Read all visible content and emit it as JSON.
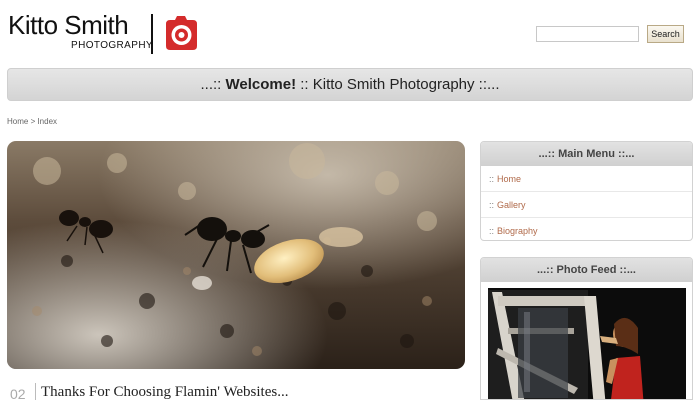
{
  "brand": {
    "name": "Kitto Smith",
    "subtitle": "PHOTOGRAPHY",
    "accent_color": "#d42b2b",
    "logo_icon": "camera-icon"
  },
  "search": {
    "placeholder": "",
    "value": "",
    "button_label": "Search"
  },
  "welcome": {
    "prefix": "...:: ",
    "bold": "Welcome!",
    "rest": " :: Kitto Smith Photography ::..."
  },
  "breadcrumb": "Home > Index",
  "hero": {
    "subject": "macro photo of ants carrying a larva"
  },
  "post": {
    "number": "02",
    "title": "Thanks For Choosing Flamin' Websites..."
  },
  "sidebar": {
    "menu_title": "...:: Main Menu ::...",
    "menu_items": [
      {
        "bullet": "::",
        "label": "Home"
      },
      {
        "bullet": "::",
        "label": "Gallery"
      },
      {
        "bullet": "::",
        "label": "Biography"
      }
    ],
    "feed_title": "...:: Photo Feed ::..."
  }
}
